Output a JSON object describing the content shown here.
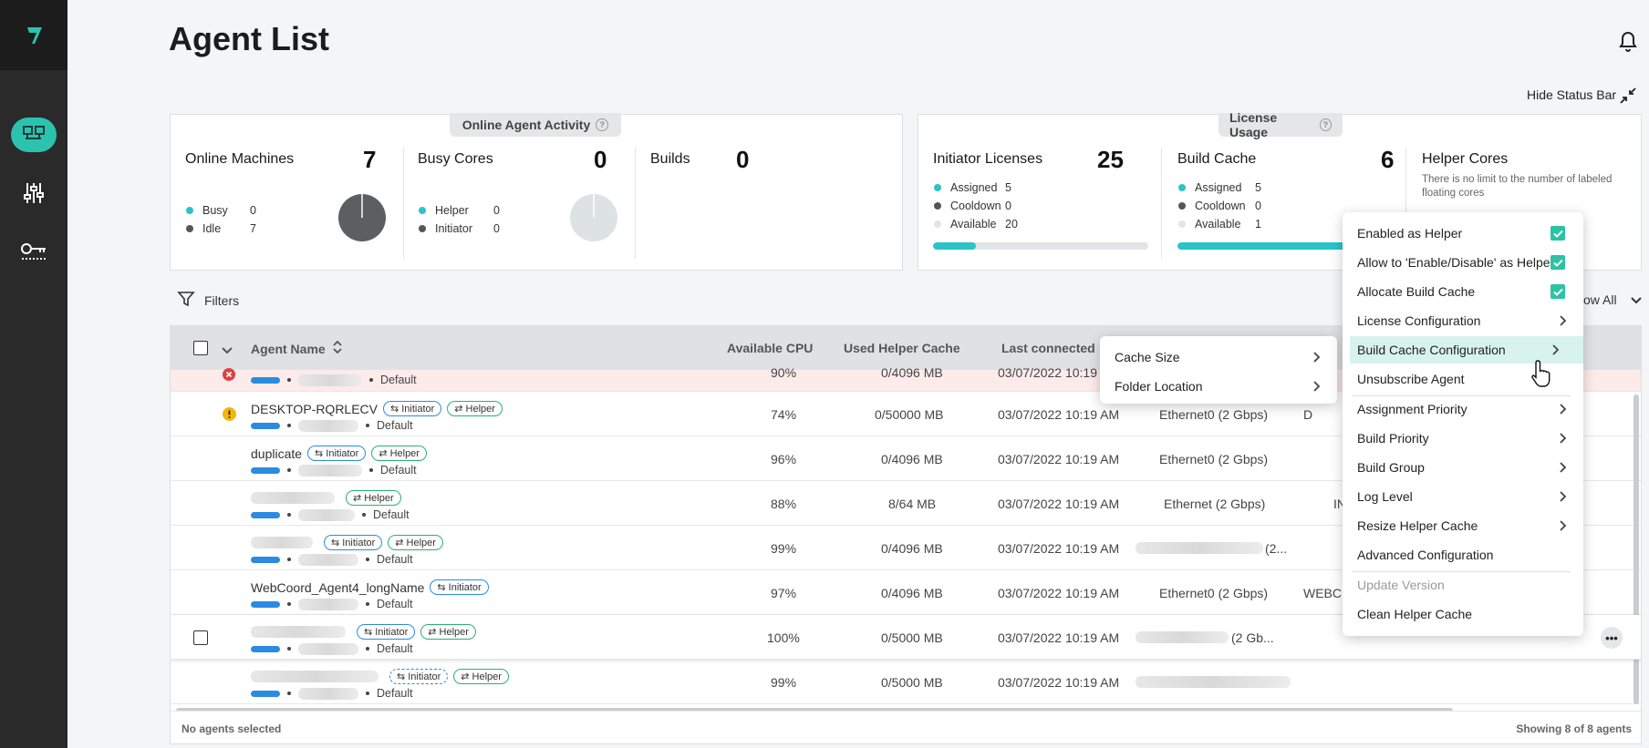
{
  "header": {
    "title": "Agent List",
    "hide_status_label": "Hide Status Bar"
  },
  "activity_panel": {
    "tab_label": "Online Agent Activity",
    "online_machines": {
      "title": "Online Machines",
      "count": "7",
      "busy_label": "Busy",
      "busy_value": "0",
      "idle_label": "Idle",
      "idle_value": "7"
    },
    "busy_cores": {
      "title": "Busy Cores",
      "count": "0",
      "helper_label": "Helper",
      "helper_value": "0",
      "initiator_label": "Initiator",
      "initiator_value": "0"
    },
    "builds": {
      "title": "Builds",
      "count": "0"
    }
  },
  "license_panel": {
    "tab_label": "License Usage",
    "initiator": {
      "title": "Initiator Licenses",
      "count": "25",
      "assigned_label": "Assigned",
      "assigned_value": "5",
      "cooldown_label": "Cooldown",
      "cooldown_value": "0",
      "available_label": "Available",
      "available_value": "20",
      "usage_fraction": 0.2
    },
    "build_cache": {
      "title": "Build Cache",
      "count": "6",
      "assigned_label": "Assigned",
      "assigned_value": "5",
      "cooldown_label": "Cooldown",
      "cooldown_value": "0",
      "available_label": "Available",
      "available_value": "1",
      "usage_fraction": 0.83
    },
    "helper_cores": {
      "title": "Helper Cores",
      "note": "There is no limit to the number of labeled floating cores"
    }
  },
  "toolbar": {
    "filters_label": "Filters",
    "show_all_label": "ow All"
  },
  "table": {
    "columns": {
      "agent_name": "Agent Name",
      "available_cpu": "Available CPU",
      "used_helper_cache": "Used Helper Cache",
      "last_connected": "Last connected"
    },
    "rows": [
      {
        "name": "",
        "group": "Default",
        "cpu": "90%",
        "cache": "0/4096 MB",
        "last": "03/07/2022 10:19",
        "net": "",
        "extra": "",
        "status": "error"
      },
      {
        "name": "DESKTOP-RQRLECV",
        "group": "Default",
        "cpu": "74%",
        "cache": "0/50000 MB",
        "last": "03/07/2022 10:19 AM",
        "net": "Ethernet0 (2 Gbps)",
        "extra": "D",
        "status": "warning"
      },
      {
        "name": "duplicate",
        "group": "Default",
        "cpu": "96%",
        "cache": "0/4096 MB",
        "last": "03/07/2022 10:19 AM",
        "net": "Ethernet0 (2 Gbps)",
        "extra": "",
        "status": ""
      },
      {
        "name": "",
        "group": "Default",
        "cpu": "88%",
        "cache": "8/64 MB",
        "last": "03/07/2022 10:19 AM",
        "net": "Ethernet (2 Gbps)",
        "extra": "IN",
        "status": ""
      },
      {
        "name": "",
        "group": "Default",
        "cpu": "99%",
        "cache": "0/4096 MB",
        "last": "03/07/2022 10:19 AM",
        "net": "(2...",
        "extra": "",
        "status": ""
      },
      {
        "name": "WebCoord_Agent4_longName",
        "group": "Default",
        "cpu": "97%",
        "cache": "0/4096 MB",
        "last": "03/07/2022 10:19 AM",
        "net": "Ethernet0 (2 Gbps)",
        "extra": "WEBC",
        "status": ""
      },
      {
        "name": "",
        "group": "Default",
        "cpu": "100%",
        "cache": "0/5000 MB",
        "last": "03/07/2022 10:19 AM",
        "net": "(2 Gb...",
        "extra": "",
        "status": ""
      },
      {
        "name": "",
        "group": "Default",
        "cpu": "99%",
        "cache": "0/5000 MB",
        "last": "03/07/2022 10:19 AM",
        "net": "",
        "extra": "",
        "status": ""
      }
    ],
    "badge_initiator": "Initiator",
    "badge_helper": "Helper",
    "footer_left": "No agents selected",
    "footer_right": "Showing 8 of 8 agents"
  },
  "submenu": {
    "items": [
      "Cache Size",
      "Folder Location"
    ]
  },
  "context_menu": {
    "items": [
      "Enabled as Helper",
      "Allow to 'Enable/Disable' as Helper",
      "Allocate Build Cache",
      "License Configuration",
      "Build Cache Configuration",
      "Unsubscribe Agent",
      "Assignment Priority",
      "Build Priority",
      "Build Group",
      "Log Level",
      "Resize Helper Cache",
      "Advanced Configuration",
      "Update Version",
      "Clean Helper Cache"
    ]
  },
  "colors": {
    "accent": "#2bc3b0",
    "initiator": "#2b8be0",
    "helper": "#29b36d",
    "error": "#e04040",
    "warning": "#f2b705"
  }
}
